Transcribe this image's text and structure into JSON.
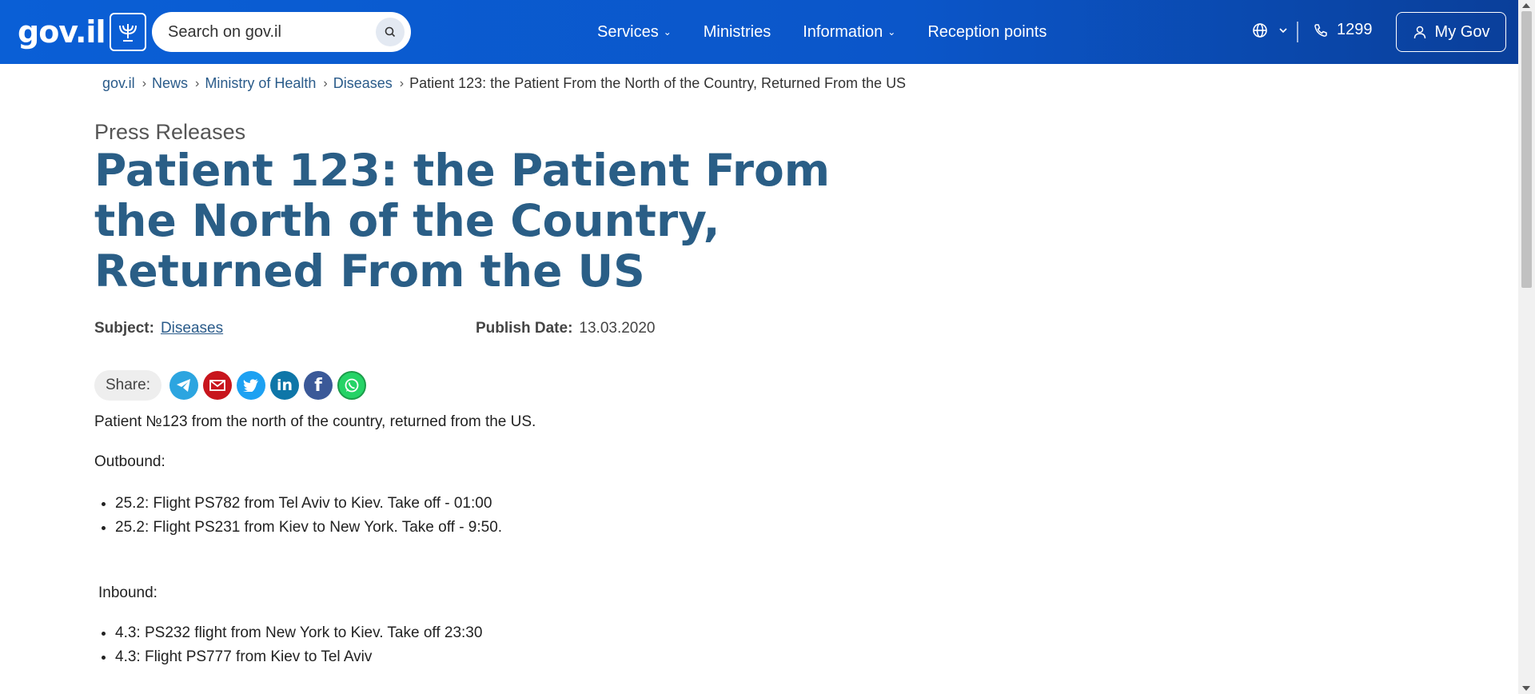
{
  "header": {
    "logo_text": "gov.il",
    "search_placeholder": "Search on gov.il",
    "nav": [
      {
        "label": "Services",
        "dropdown": true
      },
      {
        "label": "Ministries",
        "dropdown": false
      },
      {
        "label": "Information",
        "dropdown": true
      },
      {
        "label": "Reception points",
        "dropdown": false
      }
    ],
    "phone": "1299",
    "my_gov": "My Gov",
    "accent": "#0a5fd6"
  },
  "breadcrumb": {
    "items": [
      "gov.il",
      "News",
      "Ministry of Health",
      "Diseases"
    ],
    "current": "Patient 123: the Patient From the North of the Country, Returned From the US"
  },
  "page": {
    "kicker": "Press Releases",
    "title": "Patient 123: the Patient From the North of the Country, Returned From the US",
    "subject_label": "Subject:",
    "subject_value": "Diseases",
    "publish_label": "Publish Date:",
    "publish_value": "13.03.2020",
    "share_label": "Share:",
    "share_icons": [
      "telegram-icon",
      "email-icon",
      "twitter-icon",
      "linkedin-icon",
      "facebook-icon",
      "whatsapp-icon"
    ],
    "intro": "Patient №123 from the north of the country, returned from the US.",
    "outbound_label": "Outbound:",
    "outbound": [
      "25.2: Flight PS782 from Tel Aviv to Kiev. Take off -  01:00",
      "25.2: Flight PS231 from Kiev to New York. Take off - 9:50."
    ],
    "inbound_label": "Inbound:",
    "inbound": [
      "4.3: PS232 flight from New York to Kiev. Take off 23:30",
      "4.3: Flight PS777 from Kiev to Tel Aviv"
    ]
  }
}
